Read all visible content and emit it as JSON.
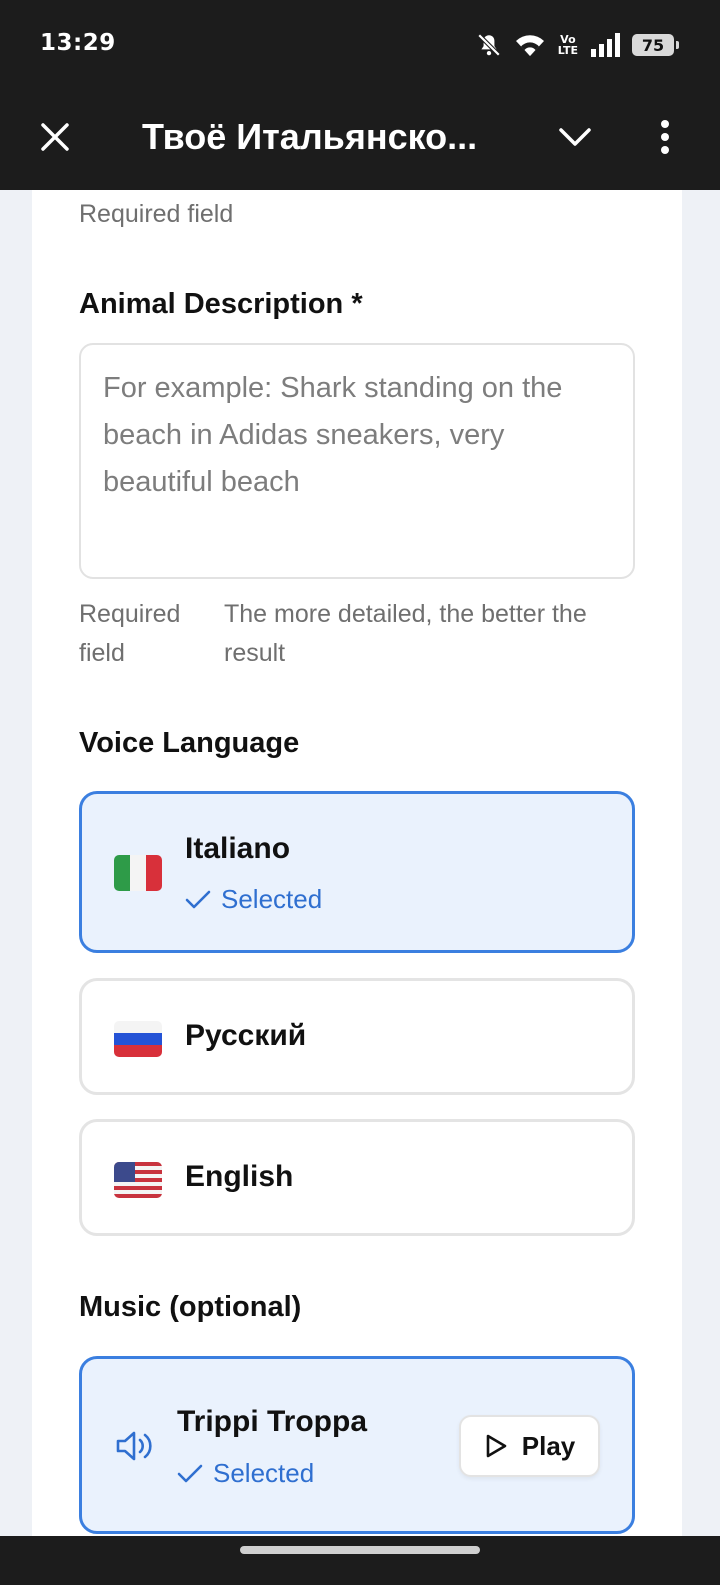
{
  "status_bar": {
    "time": "13:29",
    "volte_top": "Vo",
    "volte_bottom": "LTE",
    "battery": "75",
    "icons": [
      "bell-off-icon",
      "wifi-icon",
      "volte-icon",
      "signal-icon",
      "battery-icon"
    ]
  },
  "app_bar": {
    "title": "Твоё Итальянско...",
    "icons": [
      "close-icon",
      "chevron-down-icon",
      "more-vertical-icon"
    ]
  },
  "form": {
    "top_helper": "Required field",
    "animal_description": {
      "label": "Animal Description *",
      "value": "",
      "placeholder": "For example: Shark standing on the beach in Adidas sneakers, very beautiful beach",
      "helper_left_line1": "Required",
      "helper_left_line2": "field",
      "helper_right_line1": "The more detailed, the better the",
      "helper_right_line2": "result"
    },
    "voice_language": {
      "label": "Voice Language",
      "options": [
        {
          "name": "Italiano",
          "flag": "italy-flag-icon",
          "selected": true,
          "selected_label": "Selected"
        },
        {
          "name": "Русский",
          "flag": "russia-flag-icon",
          "selected": false
        },
        {
          "name": "English",
          "flag": "usa-flag-icon",
          "selected": false
        }
      ]
    },
    "music": {
      "label": "Music (optional)",
      "options": [
        {
          "name": "Trippi Troppa",
          "icon": "speaker-icon",
          "selected": true,
          "selected_label": "Selected",
          "play_label": "Play"
        }
      ]
    }
  },
  "colors": {
    "accent": "#3b7fe0",
    "accent_text": "#2f6fd0",
    "selected_bg": "#eaf2fd",
    "bar_bg": "#1c1c1c",
    "page_bg": "#eef1f6"
  }
}
